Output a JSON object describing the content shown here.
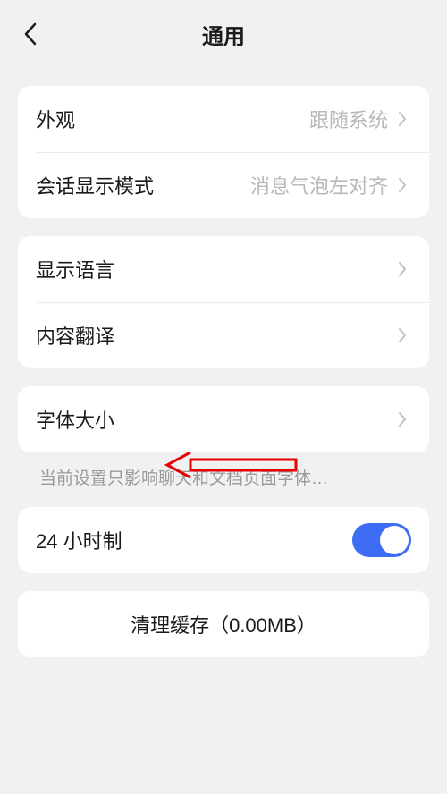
{
  "header": {
    "title": "通用"
  },
  "groups": {
    "g1": {
      "appearance": {
        "label": "外观",
        "value": "跟随系统"
      },
      "chatMode": {
        "label": "会话显示模式",
        "value": "消息气泡左对齐"
      }
    },
    "g2": {
      "language": {
        "label": "显示语言"
      },
      "translate": {
        "label": "内容翻译"
      }
    },
    "g3": {
      "fontSize": {
        "label": "字体大小"
      },
      "fontHint": "当前设置只影响聊天和文档页面字体…"
    },
    "g4": {
      "time24": {
        "label": "24 小时制",
        "on": true
      }
    },
    "g5": {
      "clearCache": {
        "label": "清理缓存（0.00MB）"
      }
    }
  },
  "colors": {
    "accent": "#3e6df4",
    "annotation": "#e60000"
  }
}
